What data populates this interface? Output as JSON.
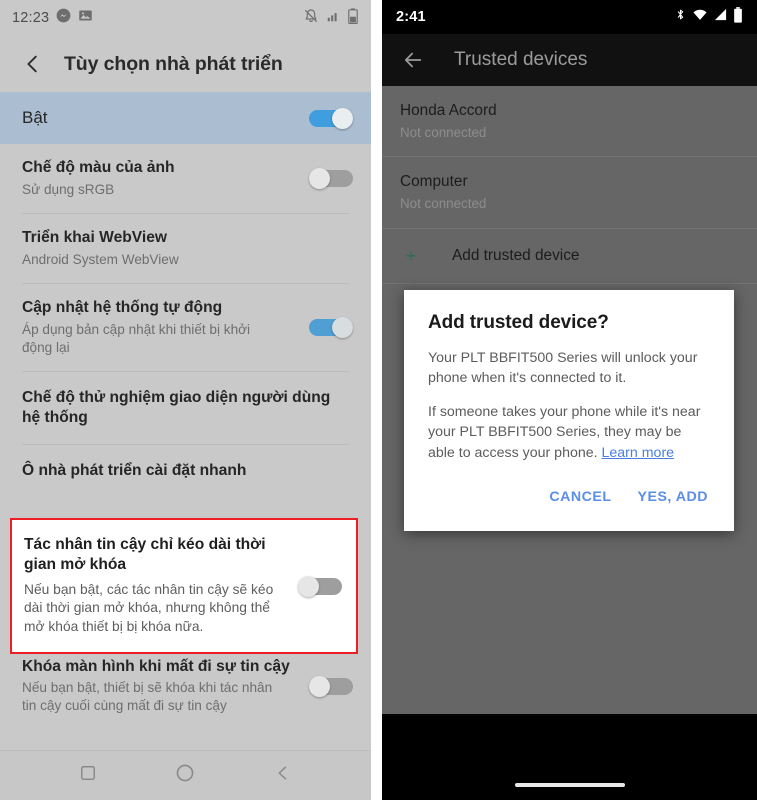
{
  "left_phone": {
    "status_bar": {
      "time": "12:23",
      "left_icons": [
        "messenger-icon",
        "photo-icon"
      ],
      "right_icons": [
        "notifications-muted-icon",
        "signal-icon",
        "battery-icon"
      ]
    },
    "app_bar": {
      "back_icon": "chevron-left-icon",
      "title": "Tùy chọn nhà phát triển"
    },
    "items": [
      {
        "title": "Bật",
        "subtitle": "",
        "toggle": "on",
        "highlighted": true
      },
      {
        "title": "Chế độ màu của ảnh",
        "subtitle": "Sử dụng sRGB",
        "toggle": "off",
        "highlighted": false
      },
      {
        "title": "Triển khai WebView",
        "subtitle": "Android System WebView",
        "toggle": "none",
        "highlighted": false
      },
      {
        "title": "Cập nhật hệ thống tự động",
        "subtitle": "Áp dụng bản cập nhật khi thiết bị khởi động lại",
        "toggle": "on",
        "highlighted": false
      },
      {
        "title": "Chế độ thử nghiệm giao diện người dùng hệ thống",
        "subtitle": "",
        "toggle": "none",
        "highlighted": false
      },
      {
        "title": "Ô nhà phát triển cài đặt nhanh",
        "subtitle": "",
        "toggle": "none",
        "highlighted": false
      }
    ],
    "highlighted_item": {
      "title": "Tác nhân tin cậy chỉ kéo dài thời gian mở khóa",
      "subtitle": "Nếu bạn bật, các tác nhân tin cậy sẽ kéo dài thời gian mở khóa, nhưng không thể mở khóa thiết bị bị khóa nữa.",
      "toggle": "off",
      "annotation_color": "#ec2024"
    },
    "last_item": {
      "title": "Khóa màn hình khi mất đi sự tin cậy",
      "subtitle": "Nếu bạn bật, thiết bị sẽ khóa khi tác nhân tin cậy cuối cùng mất đi sự tin cậy",
      "toggle": "off"
    },
    "nav_bar": {
      "recents_icon": "square-icon",
      "home_icon": "circle-icon",
      "back_icon": "chevron-left-icon"
    }
  },
  "right_phone": {
    "status_bar": {
      "time": "2:41",
      "right_icons": [
        "bluetooth-icon",
        "wifi-icon",
        "signal-icon",
        "battery-icon"
      ]
    },
    "app_bar": {
      "back_icon": "arrow-left-icon",
      "title": "Trusted devices"
    },
    "devices": [
      {
        "name": "Honda Accord",
        "status": "Not connected"
      },
      {
        "name": "Computer",
        "status": "Not connected"
      }
    ],
    "add_device": {
      "plus_icon": "plus-icon",
      "label": "Add trusted device"
    },
    "dialog": {
      "title": "Add trusted device?",
      "paragraph_1": "Your PLT BBFIT500 Series will unlock your phone when it's connected to it.",
      "paragraph_2_prefix": "If someone takes your phone while it's near your PLT BBFIT500 Series, they may be able to access your phone. ",
      "learn_more": "Learn more",
      "cancel_label": "CANCEL",
      "confirm_label": "YES, ADD",
      "accent_color": "#5a8ee8"
    },
    "nav_bar": {
      "home_pill": "home-pill-indicator"
    }
  }
}
